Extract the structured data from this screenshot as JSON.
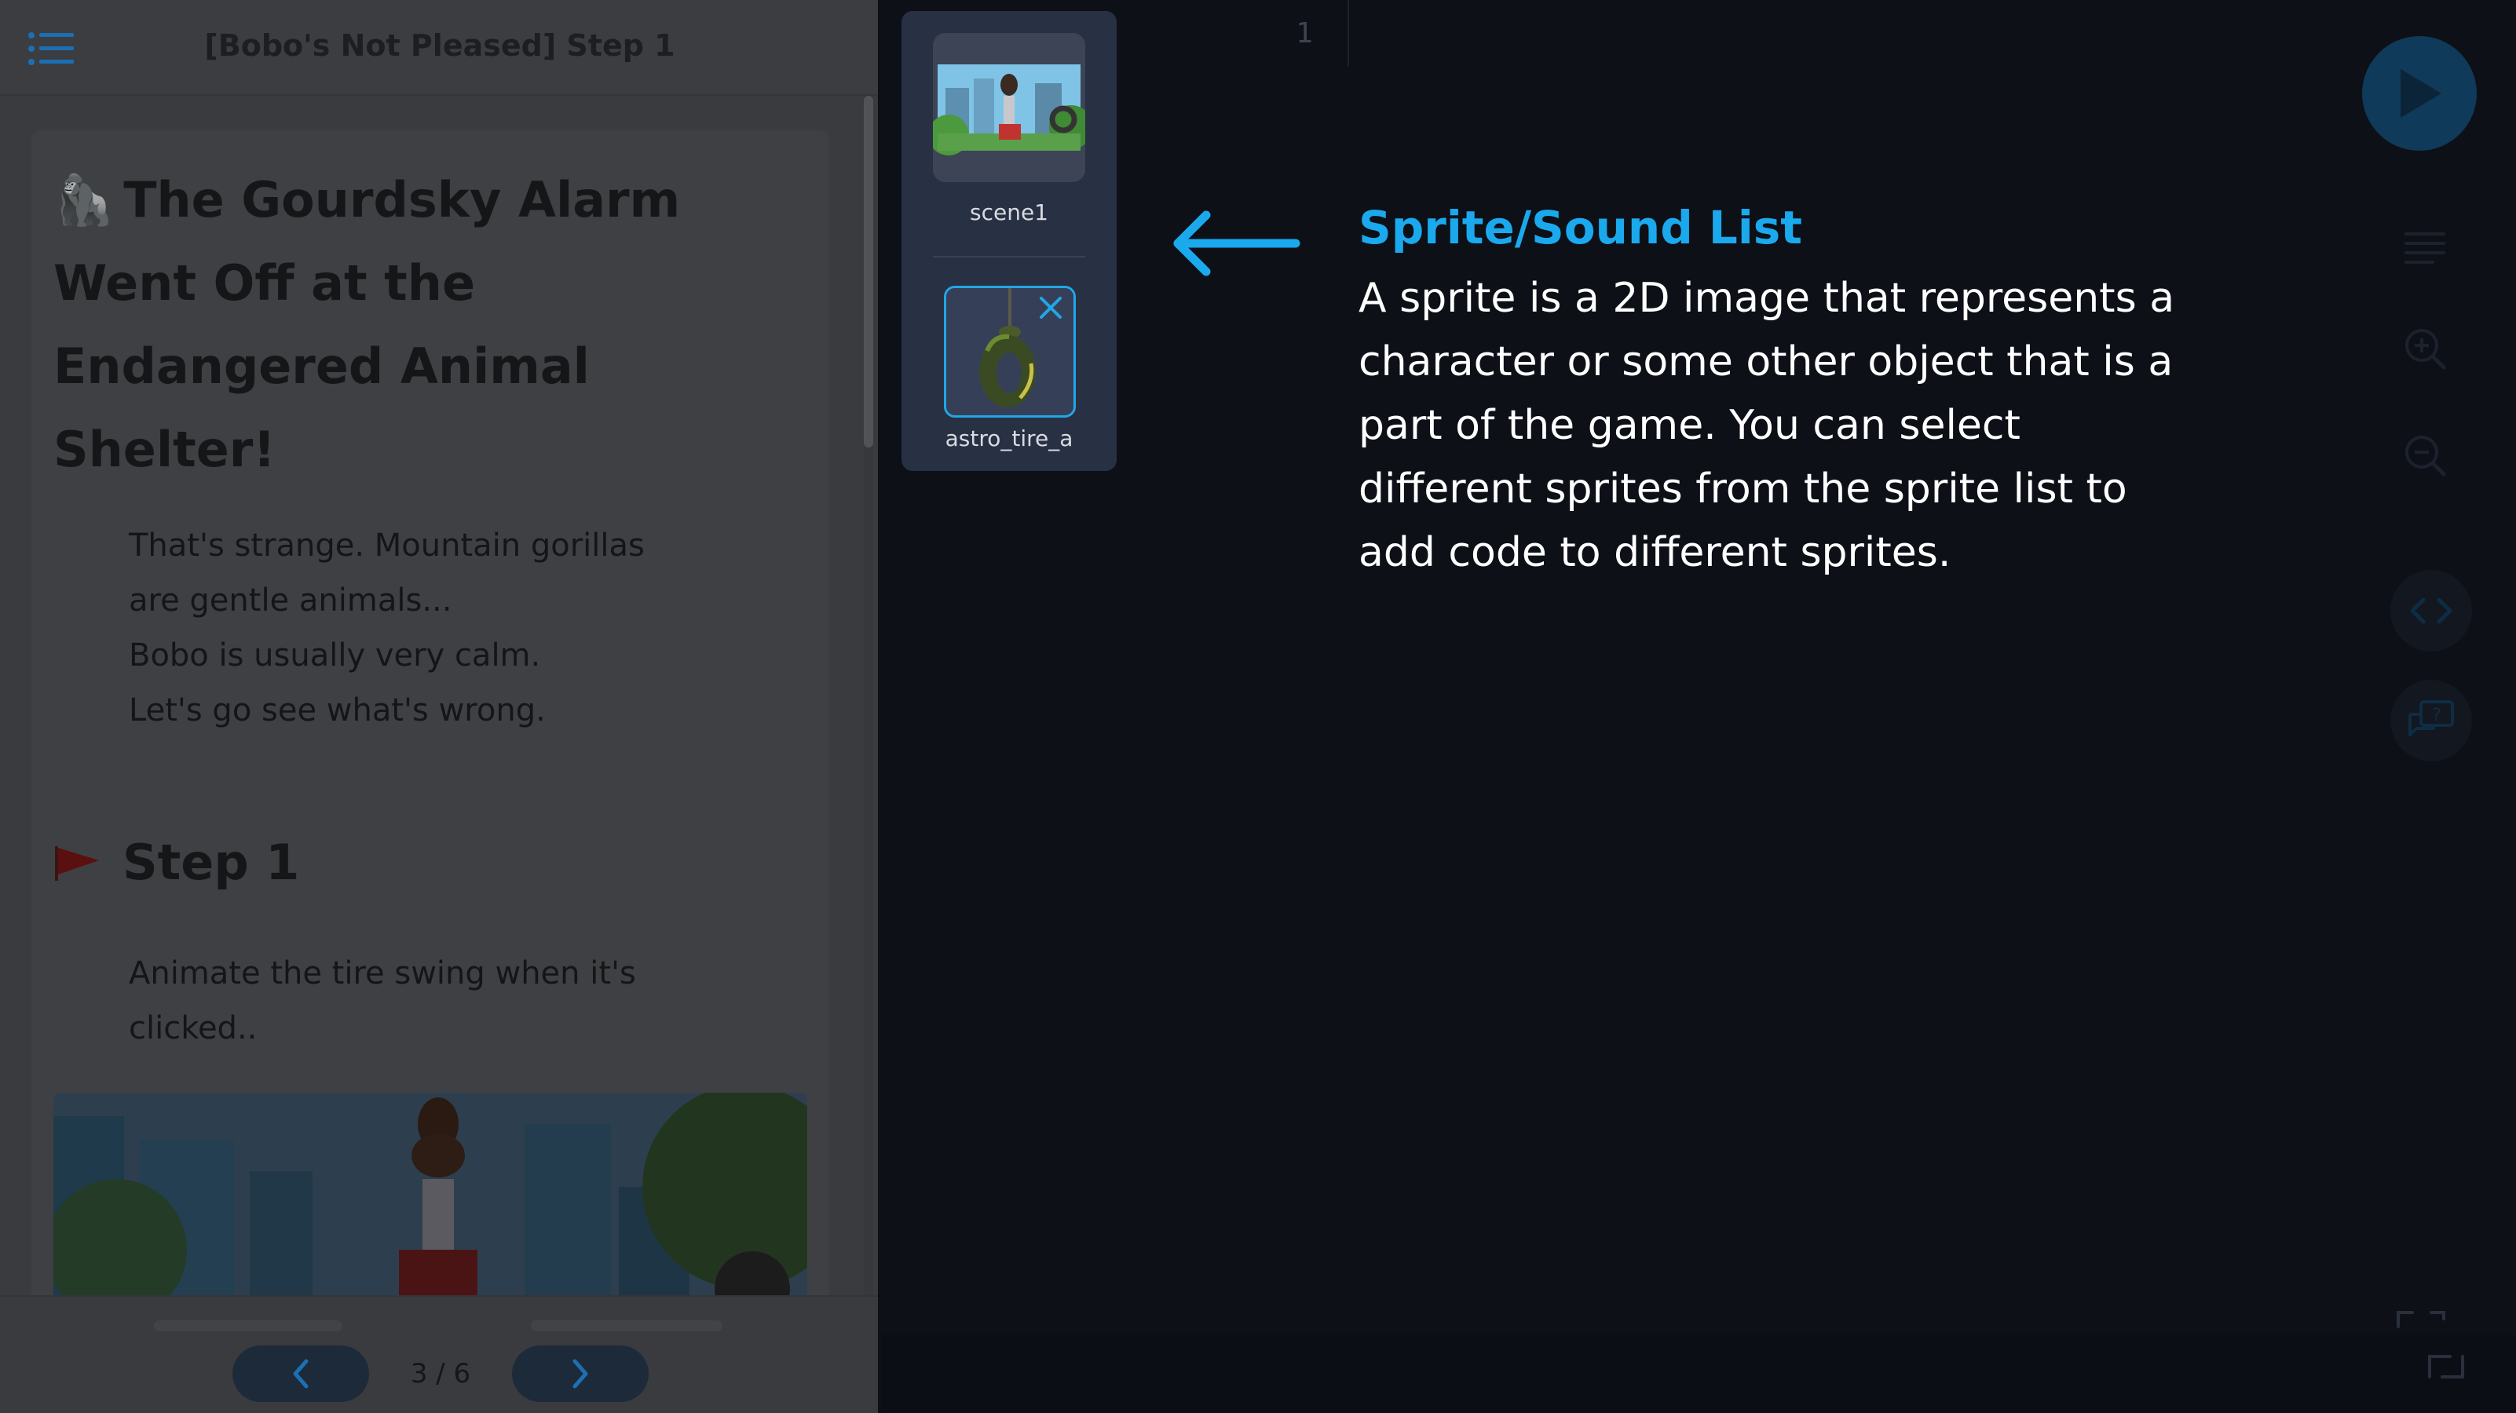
{
  "lesson": {
    "title": "[Bobo's Not Pleased] Step 1",
    "heading_emoji": "🦍",
    "heading_lines": [
      "The Gourdsky Alarm",
      "Went Off at the",
      "Endangered Animal",
      "Shelter!"
    ],
    "intro_lines": [
      "That's strange. Mountain gorillas",
      "are gentle animals...",
      "Bobo is usually very calm.",
      "Let's go see what's wrong."
    ],
    "step_heading": "Step 1",
    "step_lines": [
      "Animate the tire swing when it's",
      "clicked.."
    ]
  },
  "pager": {
    "label": "3 / 6",
    "current": 3,
    "total": 6
  },
  "sprites": [
    {
      "name": "scene1",
      "icon": "city-scene-thumbnail"
    },
    {
      "name": "astro_tire_a",
      "icon": "tire-swing-thumbnail",
      "selected": true
    }
  ],
  "editor": {
    "line_number": "1"
  },
  "callout": {
    "title": "Sprite/Sound List",
    "body_lines": [
      "A sprite is a 2D image that represents a",
      "character or some other object that is a",
      "part of the game. You can select",
      "different sprites from the sprite list to",
      "add code to different sprites."
    ]
  },
  "colors": {
    "accent": "#1ba9ee",
    "run_button": "#0f3a59",
    "overlay_panel": "#3a3b3e",
    "background": "#0d1017"
  }
}
